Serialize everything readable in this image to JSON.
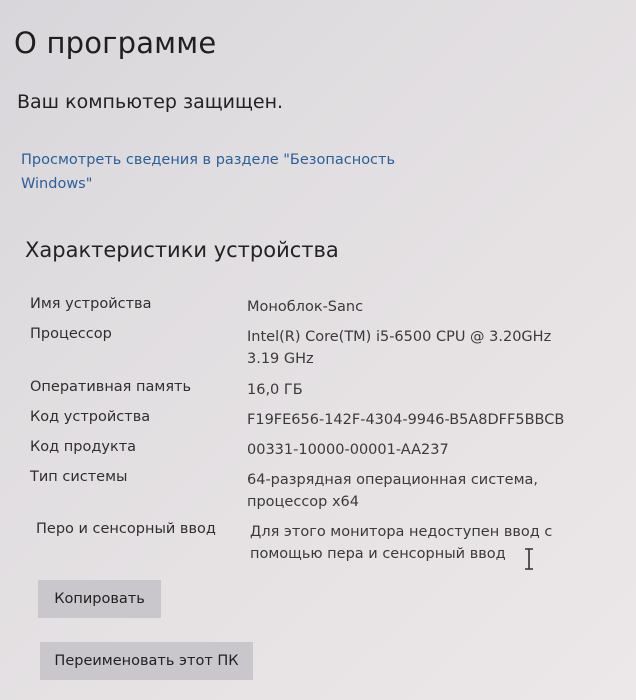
{
  "page": {
    "title": "О программе",
    "protection_status": "Ваш компьютер защищен.",
    "security_link": "Просмотреть сведения в разделе \"Безопасность Windows\""
  },
  "device_specs": {
    "section_title": "Характеристики устройства",
    "rows": [
      {
        "label": "Имя устройства",
        "value": "Моноблок-Sanc"
      },
      {
        "label": "Процессор",
        "value": "Intel(R) Core(TM) i5-6500 CPU @ 3.20GHz 3.19 GHz"
      },
      {
        "label": "Оперативная память",
        "value": "16,0 ГБ"
      },
      {
        "label": "Код устройства",
        "value": "F19FE656-142F-4304-9946-B5A8DFF5BBCB"
      },
      {
        "label": "Код продукта",
        "value": "00331-10000-00001-AA237"
      },
      {
        "label": "Тип системы",
        "value": "64-разрядная операционная система, процессор x64"
      },
      {
        "label": "Перо и сенсорный ввод",
        "value": "Для этого монитора недоступен ввод с помощью пера и сенсорный ввод"
      }
    ]
  },
  "buttons": {
    "copy_label": "Копировать",
    "rename_label": "Переименовать этот ПК"
  },
  "icons": {
    "cursor": "text-cursor-icon"
  }
}
